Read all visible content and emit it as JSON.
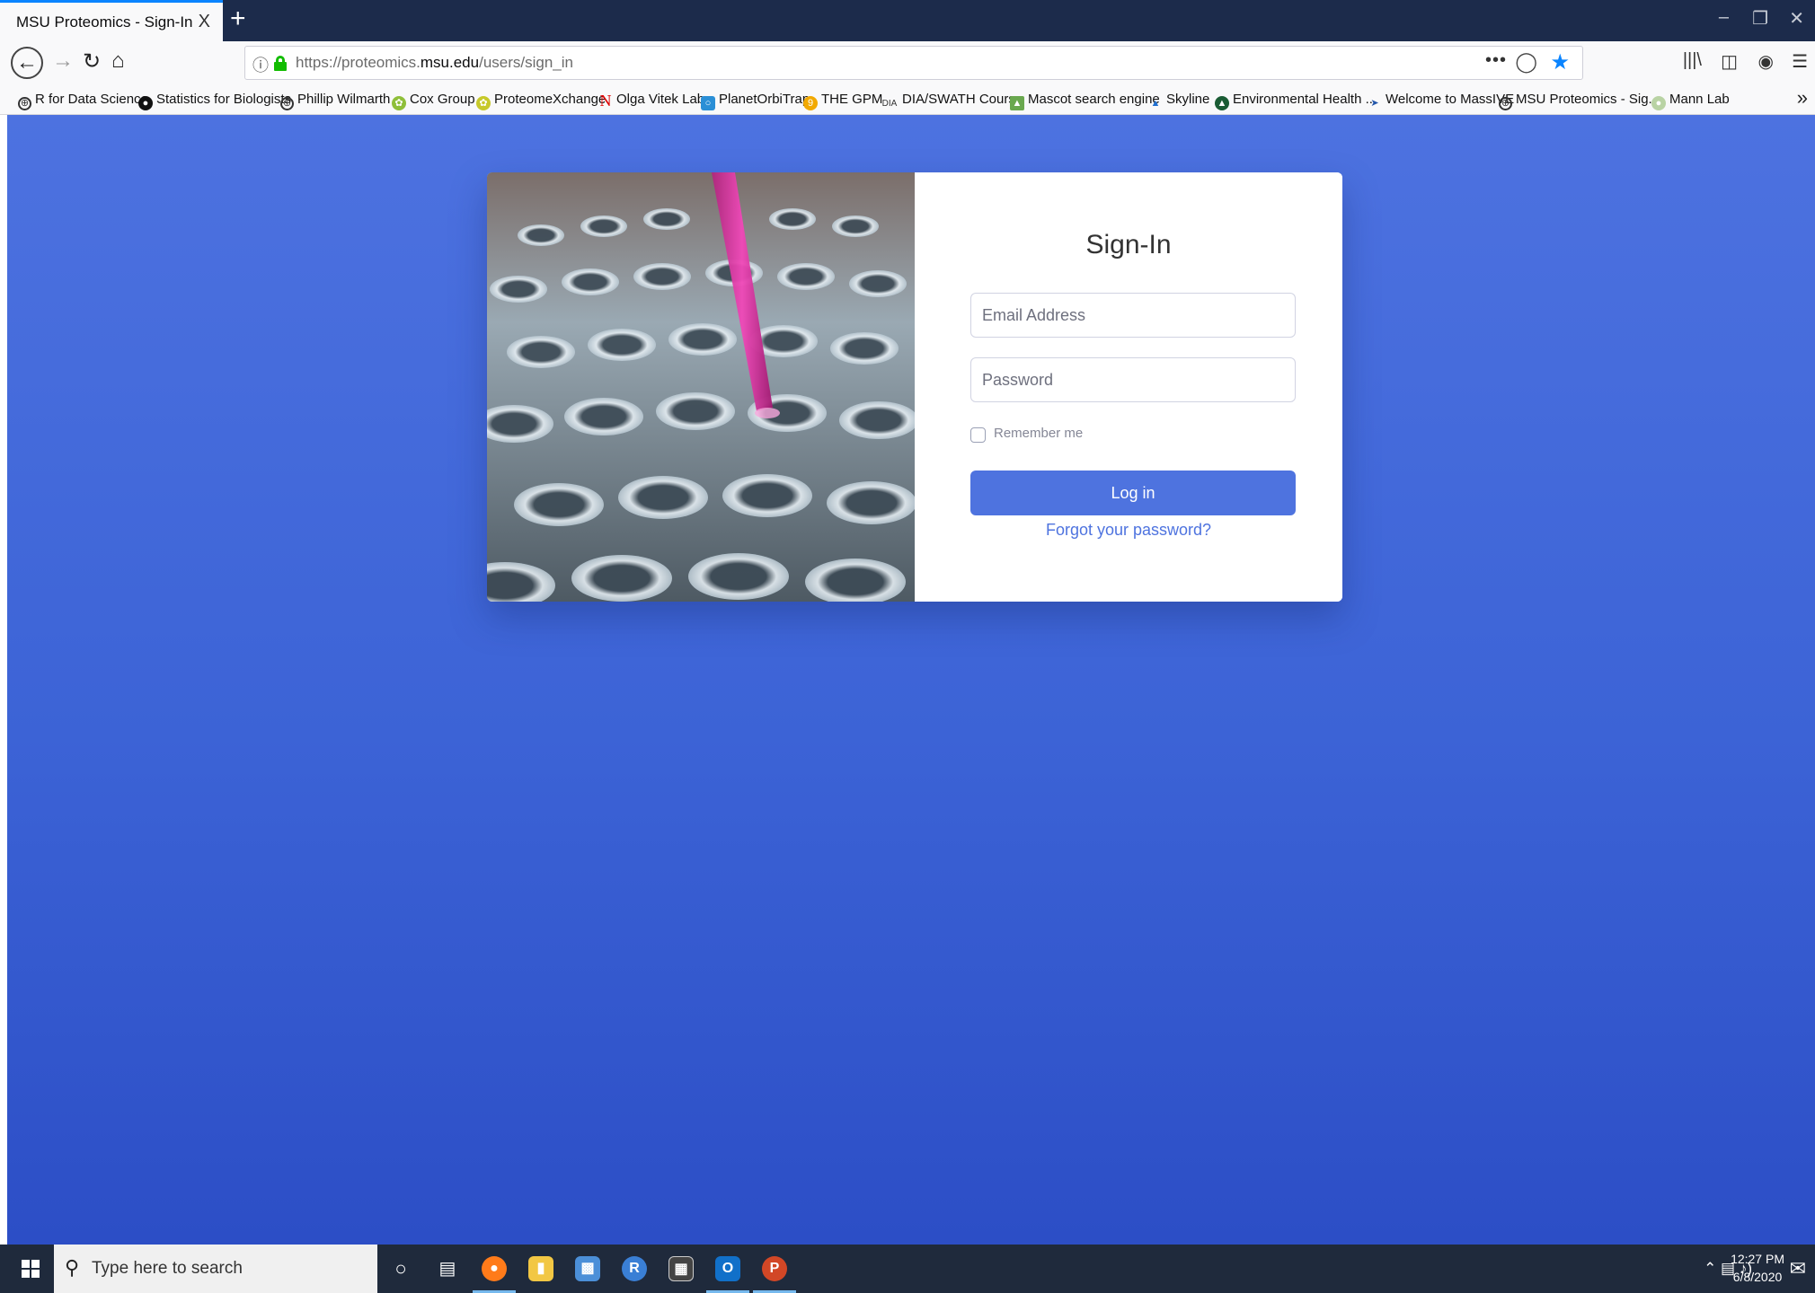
{
  "browser": {
    "tab_title": "MSU Proteomics - Sign-In",
    "tab_close": "X",
    "new_tab": "+",
    "url_prefix": "https://proteomics.",
    "url_domain": "msu.edu",
    "url_path": "/users/sign_in",
    "page_actions": "•••",
    "bookmarks": [
      "R for Data Science",
      "Statistics for Biologists",
      "Phillip Wilmarth",
      "Cox Group",
      "ProteomeXchange",
      "Olga Vitek Lab",
      "PlanetOrbiTrap",
      "THE GPM",
      "DIA/SWATH Course",
      "Mascot search engine",
      "Skyline",
      "Environmental Health ...",
      "Welcome to MassIVE",
      "MSU Proteomics - Sig...",
      "Mann Lab"
    ]
  },
  "signin": {
    "title": "Sign-In",
    "email_placeholder": "Email Address",
    "password_placeholder": "Password",
    "remember_label": "Remember me",
    "login_label": "Log in",
    "forgot_label": "Forgot your password?"
  },
  "taskbar": {
    "search_placeholder": "Type here to search",
    "time": "12:27 PM",
    "date": "6/8/2020"
  },
  "colors": {
    "accent": "#4e73df",
    "page_gradient_top": "#4d72e0",
    "page_gradient_bottom": "#2c4ec6"
  }
}
